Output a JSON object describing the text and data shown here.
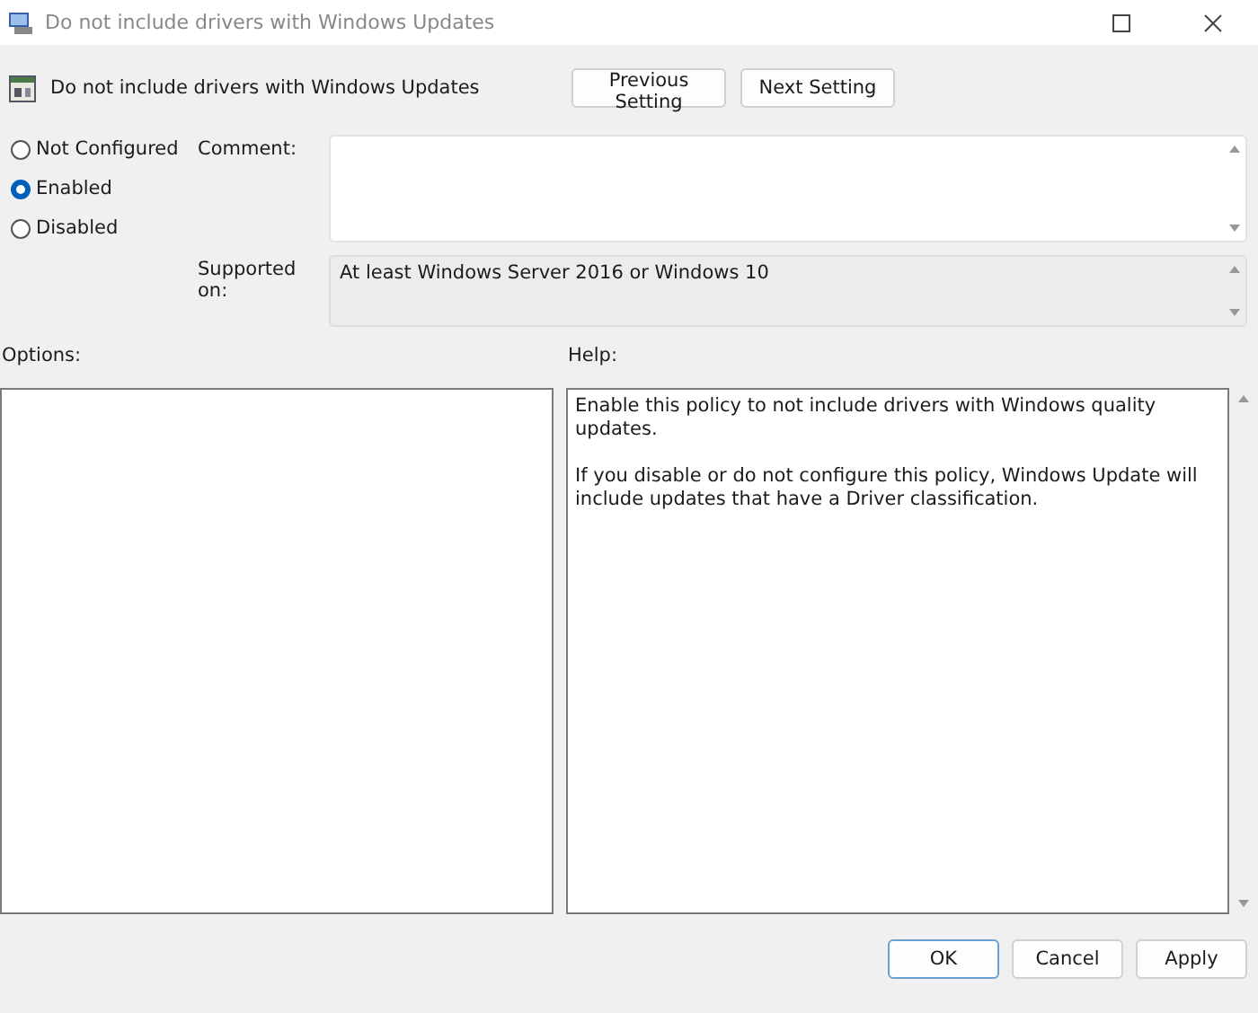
{
  "window": {
    "title": "Do not include drivers with Windows Updates"
  },
  "header": {
    "title": "Do not include drivers with Windows Updates",
    "buttons": [
      "Previous Setting",
      "Next Setting"
    ]
  },
  "states": [
    {
      "label": "Not Configured",
      "selected": false
    },
    {
      "label": "Enabled",
      "selected": true
    },
    {
      "label": "Disabled",
      "selected": false
    }
  ],
  "comment": {
    "label": "Comment:"
  },
  "supported_on": {
    "label": "Supported on:",
    "value": "At least Windows Server 2016 or Windows 10"
  },
  "options": {
    "label": "Options:"
  },
  "help": {
    "label": "Help:",
    "paragraphs": [
      "Enable this policy to not include drivers with Windows quality updates.",
      "If you disable or do not configure this policy, Windows Update will include updates that have a Driver classification."
    ]
  },
  "buttons": [
    "OK",
    "Cancel",
    "Apply"
  ]
}
